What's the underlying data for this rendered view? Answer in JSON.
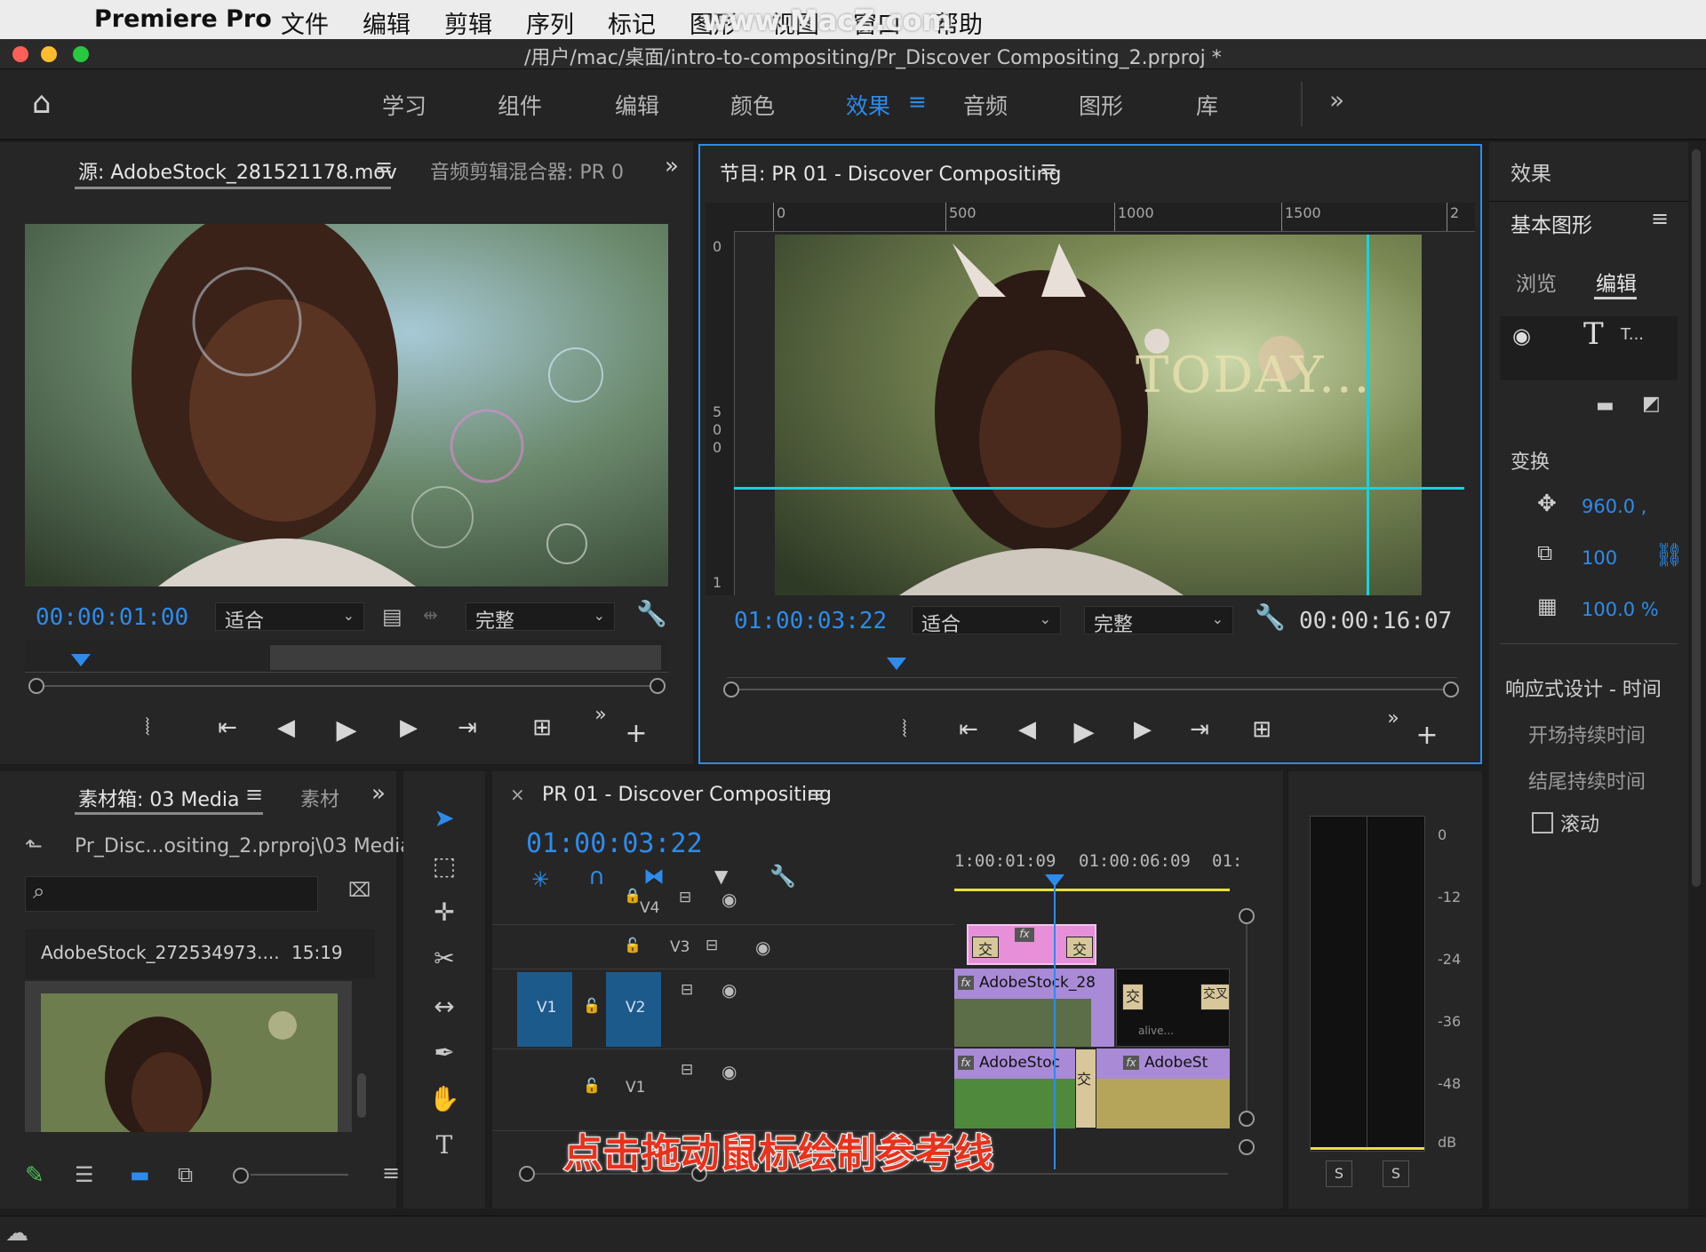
{
  "menubar": {
    "app": "Premiere Pro",
    "items": [
      "文件",
      "编辑",
      "剪辑",
      "序列",
      "标记",
      "图形",
      "视图",
      "窗口",
      "帮助"
    ],
    "watermark": "www.MacZ.com"
  },
  "titlebar": {
    "path": "/用户/mac/桌面/intro-to-compositing/Pr_Discover Compositing_2.prproj *"
  },
  "workspaces": {
    "items": [
      "学习",
      "组件",
      "编辑",
      "颜色",
      "效果",
      "音频",
      "图形",
      "库"
    ],
    "active": "效果",
    "more": "»"
  },
  "source": {
    "tab": "源: AdobeStock_281521178.mov",
    "tab2": "音频剪辑混合器: PR 0",
    "timecode": "00:00:01:00",
    "fit": "适合",
    "quality": "完整"
  },
  "program": {
    "tab": "节目: PR 01 - Discover Compositing",
    "timecode": "01:00:03:22",
    "fit": "适合",
    "quality": "完整",
    "duration": "00:00:16:07",
    "ruler": [
      "0",
      "500",
      "1000",
      "1500",
      "2"
    ],
    "vruler": [
      "0",
      "5",
      "0",
      "0",
      "1"
    ],
    "overlay_text": "TODAY..."
  },
  "effects": {
    "panel_title": "效果",
    "egraphics_title": "基本图形",
    "tab_browse": "浏览",
    "tab_edit": "编辑",
    "layer_label": "T...",
    "transform_title": "变换",
    "position": "960.0 ,",
    "scale": "100",
    "opacity": "100.0 %",
    "responsive_title": "响应式设计 - 时间",
    "intro_duration": "开场持续时间",
    "outro_duration": "结尾持续时间",
    "roll_label": "滚动"
  },
  "bin": {
    "tab": "素材箱: 03 Media",
    "tab2": "素材",
    "path": "Pr_Disc...ositing_2.prproj\\03 Media",
    "item_name": "AdobeStock_272534973....",
    "item_duration": "15:19"
  },
  "timeline": {
    "tab": "PR 01 - Discover Compositing",
    "timecode": "01:00:03:22",
    "ruler": [
      "1:00:01:09",
      "01:00:06:09",
      "01:"
    ],
    "tracks": {
      "v4": "V4",
      "v3": "V3",
      "v2": "V2",
      "v1": "V1",
      "src_v1": "V1"
    },
    "clip_v2": "AdobeStock_28",
    "clip_v1a": "AdobeStoc",
    "clip_v1b": "AdobeSt",
    "trans": "交",
    "trans2": "交叉",
    "alive": "alive..."
  },
  "meter": {
    "scale": [
      "0",
      "-12",
      "-24",
      "-36",
      "-48",
      "dB"
    ],
    "solo": "S"
  },
  "caption": "点击拖动鼠标绘制参考线",
  "colors": {
    "accent": "#2d8ceb",
    "guide": "#14d4e0",
    "clip_purple": "#a98ad6",
    "clip_pink": "#e78fd8",
    "caption_red": "#e8321c"
  }
}
